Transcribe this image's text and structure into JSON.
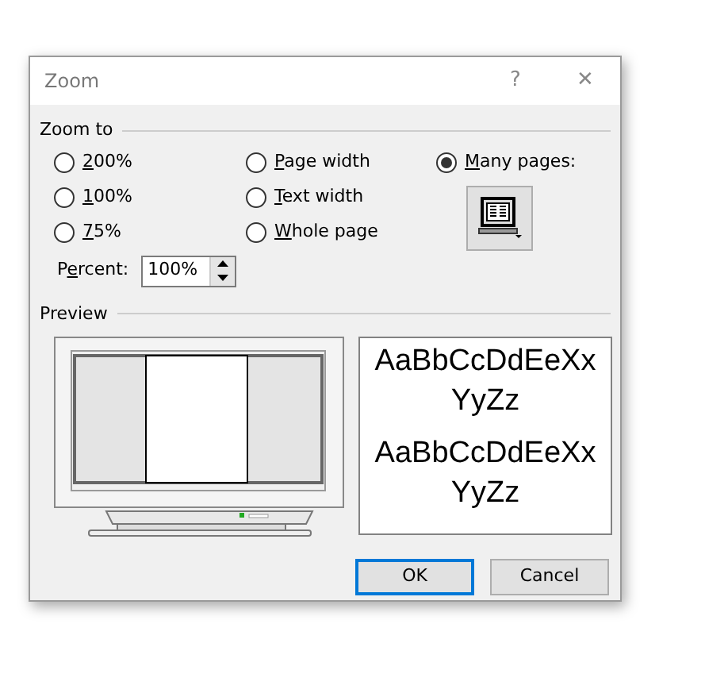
{
  "window": {
    "title": "Zoom",
    "help": "?",
    "close": "✕"
  },
  "zoom_to": {
    "heading": "Zoom to",
    "columns": [
      [
        {
          "key": "2",
          "rest": "00%",
          "selected": false
        },
        {
          "key": "1",
          "rest": "00%",
          "selected": false
        },
        {
          "key": "7",
          "rest": "5%",
          "selected": false
        }
      ],
      [
        {
          "key": "P",
          "rest": "age width",
          "selected": false
        },
        {
          "key": "T",
          "rest": "ext width",
          "selected": false
        },
        {
          "key": "W",
          "rest": "hole page",
          "selected": false
        }
      ],
      [
        {
          "key": "M",
          "rest": "any pages:",
          "selected": true
        }
      ]
    ],
    "percent": {
      "before": "P",
      "key": "e",
      "rest": "rcent:",
      "value": "100%"
    }
  },
  "preview": {
    "heading": "Preview",
    "samples": [
      [
        "AaBbCcDdEeXx",
        "YyZz"
      ],
      [
        "AaBbCcDdEeXx",
        "YyZz"
      ]
    ]
  },
  "buttons": [
    {
      "label": "OK",
      "default": true
    },
    {
      "label": "Cancel",
      "default": false
    }
  ]
}
